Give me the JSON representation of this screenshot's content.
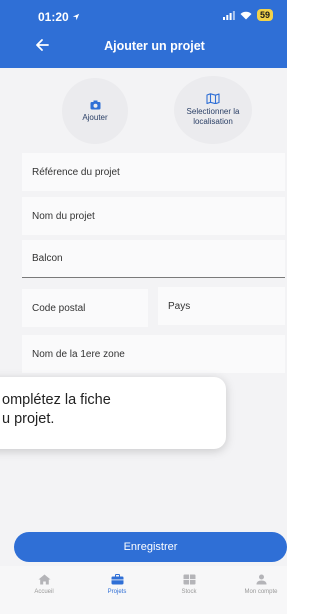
{
  "status": {
    "time": "01:20",
    "battery": "59"
  },
  "header": {
    "title": "Ajouter un projet"
  },
  "actions": {
    "photo_label": "Ajouter",
    "map_label_line1": "Selectionner la",
    "map_label_line2": "localisation"
  },
  "form": {
    "reference_placeholder": "Référence du projet",
    "name_placeholder": "Nom du projet",
    "balcon_value": "Balcon",
    "postal_placeholder": "Code postal",
    "country_placeholder": "Pays",
    "zone_placeholder": "Nom de la 1ere zone"
  },
  "tooltip": {
    "line1": "omplétez la fiche",
    "line2": "u projet."
  },
  "save_label": "Enregistrer",
  "nav": {
    "items": [
      {
        "label": "Accueil",
        "icon": "home-icon"
      },
      {
        "label": "Projets",
        "icon": "briefcase-icon"
      },
      {
        "label": "Stock",
        "icon": "stock-icon"
      },
      {
        "label": "Mon compte",
        "icon": "user-icon"
      }
    ]
  },
  "colors": {
    "primary": "#2f6fd6",
    "icon_dark": "#2a3f66"
  }
}
